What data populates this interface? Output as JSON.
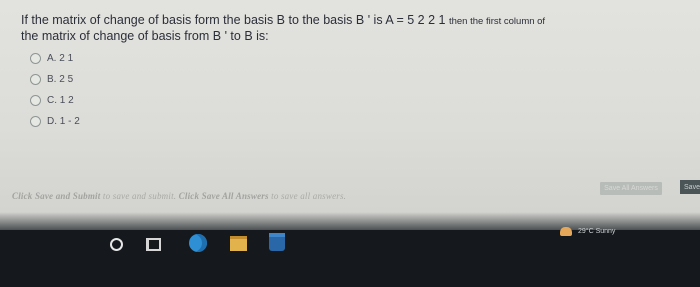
{
  "question": {
    "line1_main": "If the matrix of change of basis form the basis  B to the basis  B ' is  A = 5 2 2 1 ",
    "line1_tail": "then the first column of",
    "line2": "the matrix of change of basis from B ' to  B is:"
  },
  "options": [
    {
      "label": "A. 2 1"
    },
    {
      "label": "B. 2 5"
    },
    {
      "label": "C. 1 2"
    },
    {
      "label": "D. 1 - 2"
    }
  ],
  "footer": {
    "hint_prefix": "Click Save and Submit",
    "hint_mid": " to save and submit. ",
    "hint_save_all": "Click Save All Answers",
    "hint_suffix": " to save all answers."
  },
  "buttons": {
    "save_all": "Save All Answers",
    "submit": "Save"
  },
  "tray": {
    "weather": "29°C Sunny"
  },
  "colors": {
    "page_bg": "#dcdcd8",
    "text": "#2b2f3a",
    "taskbar": "#15191d",
    "edge_blue": "#2f8fd4"
  },
  "icons": [
    "radio-icon",
    "start-icon",
    "task-view-icon",
    "edge-icon",
    "file-explorer-icon",
    "store-icon",
    "weather-icon"
  ]
}
